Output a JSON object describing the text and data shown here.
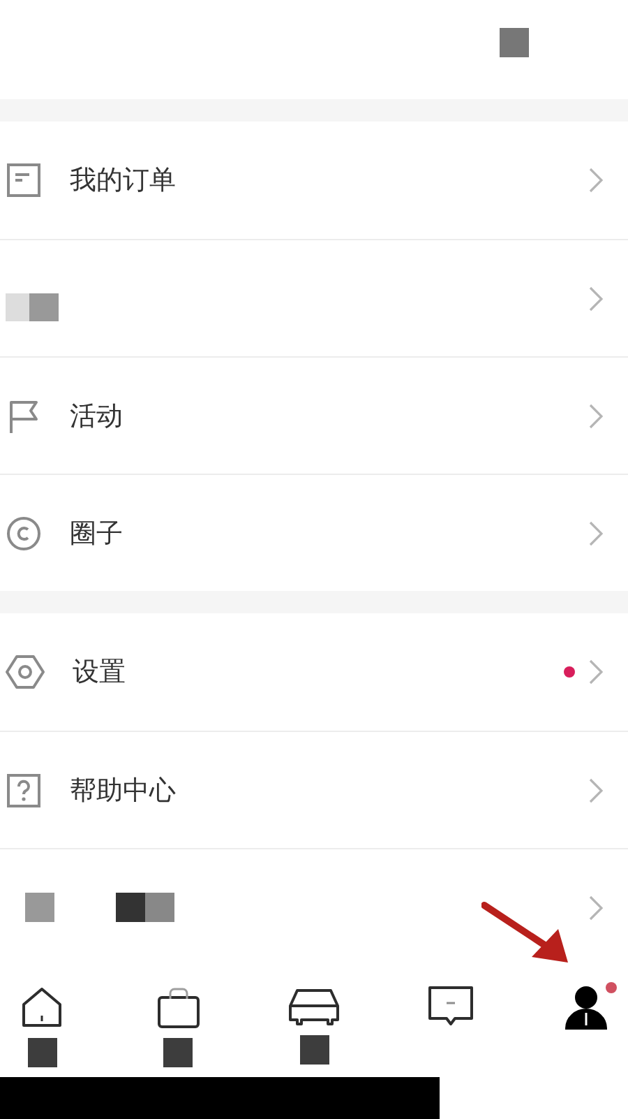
{
  "header": {
    "kind": "redacted"
  },
  "sections": [
    {
      "items": [
        {
          "kind": "text",
          "label": "我的订单",
          "dot": false
        },
        {
          "kind": "redacted",
          "dot": false
        },
        {
          "kind": "text",
          "label": "活动",
          "dot": false
        },
        {
          "kind": "text",
          "label": "圈子",
          "dot": false
        }
      ]
    },
    {
      "items": [
        {
          "kind": "text",
          "label": "设置",
          "dot": true
        },
        {
          "kind": "text",
          "label": "帮助中心",
          "dot": false
        },
        {
          "kind": "redacted",
          "dot": false
        }
      ]
    }
  ],
  "tabs": [
    {
      "selected": false,
      "dot": false,
      "label_redacted": true
    },
    {
      "selected": false,
      "dot": false,
      "label_redacted": true
    },
    {
      "selected": false,
      "dot": false,
      "label_redacted": true
    },
    {
      "selected": false,
      "dot": false,
      "label_redacted": false
    },
    {
      "selected": true,
      "dot": true,
      "label_redacted": false
    }
  ]
}
